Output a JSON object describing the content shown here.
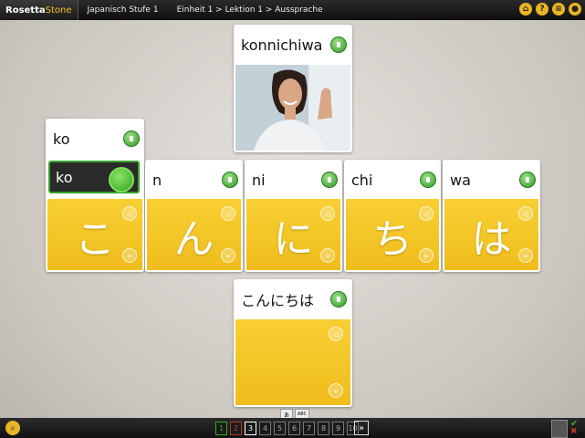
{
  "topbar": {
    "logo_main": "Rosetta",
    "logo_accent": "Stone",
    "course": "Japanisch Stufe 1",
    "breadcrumb": "Einheit 1 > Lektion 1 > Aussprache",
    "icons": [
      "home-icon",
      "help-icon",
      "menu-icon",
      "user-icon"
    ],
    "help_glyph": "?"
  },
  "picture_card": {
    "word": "konnichiwa"
  },
  "syllables": [
    {
      "romaji": "ko",
      "kana": "こ"
    },
    {
      "romaji": "n",
      "kana": "ん"
    },
    {
      "romaji": "ni",
      "kana": "に"
    },
    {
      "romaji": "chi",
      "kana": "ち"
    },
    {
      "romaji": "wa",
      "kana": "は"
    }
  ],
  "selected": {
    "label_top": "ko",
    "label_active": "ko"
  },
  "word_card": {
    "kana": "こんにちは"
  },
  "toggle": {
    "abc": "ABC"
  },
  "pager": {
    "pages": [
      "1",
      "2",
      "3",
      "4",
      "5",
      "6",
      "7",
      "8",
      "9",
      "10"
    ],
    "current": "3",
    "next": "»"
  },
  "colors": {
    "yellow": "#f2c01e",
    "green": "#37a32c",
    "bar": "#1a1a1a"
  }
}
